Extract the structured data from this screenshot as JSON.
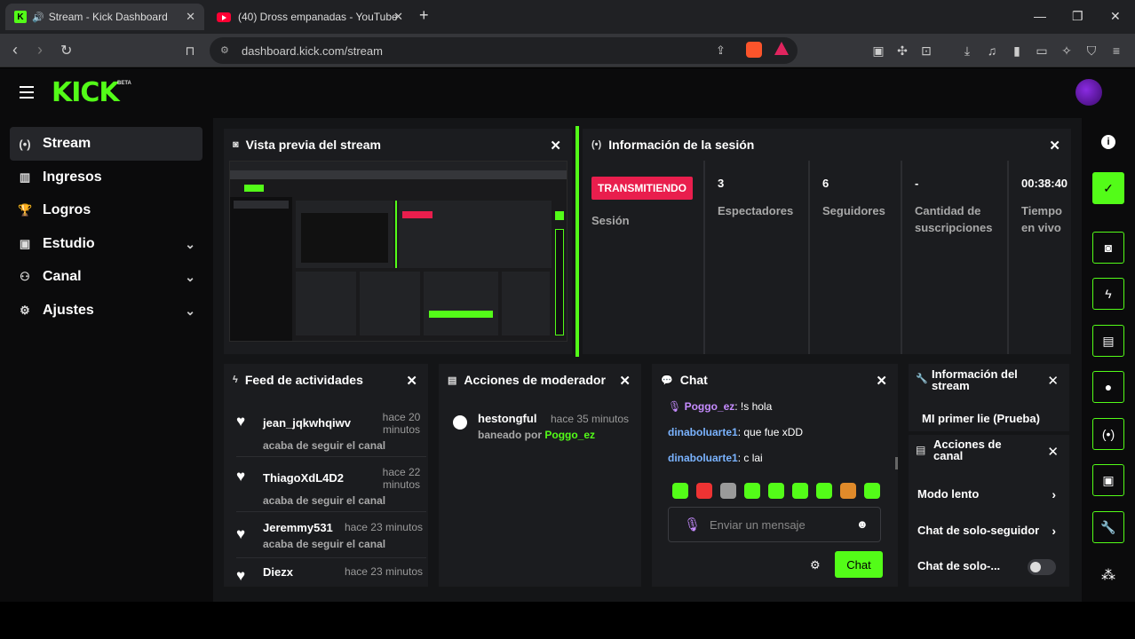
{
  "browser": {
    "tabs": [
      {
        "title": "Stream - Kick Dashboard"
      },
      {
        "title": "(40) Dross empanadas - YouTube"
      }
    ],
    "url": "dashboard.kick.com/stream"
  },
  "header": {
    "logo": "KICK",
    "beta": "BETA"
  },
  "sidebar": {
    "items": [
      {
        "label": "Stream",
        "icon": "broadcast-icon"
      },
      {
        "label": "Ingresos",
        "icon": "chart-icon"
      },
      {
        "label": "Logros",
        "icon": "trophy-icon"
      },
      {
        "label": "Estudio",
        "icon": "studio-icon"
      },
      {
        "label": "Canal",
        "icon": "users-icon"
      },
      {
        "label": "Ajustes",
        "icon": "gear-icon"
      }
    ]
  },
  "preview": {
    "title": "Vista previa del stream"
  },
  "session": {
    "title": "Información de la sesión",
    "badge": "TRANSMITIENDO",
    "session_label": "Sesión",
    "stats": [
      {
        "value": "3",
        "label": "Espectadores"
      },
      {
        "value": "6",
        "label": "Seguidores"
      },
      {
        "value": "-",
        "label": "Cantidad de suscripciones"
      },
      {
        "value": "00:38:40",
        "label": "Tiempo en vivo"
      }
    ]
  },
  "feed": {
    "title": "Feed de actividades",
    "items": [
      {
        "name": "jean_jqkwhqiwv",
        "when": "hace 20 minutos",
        "action": "acaba de seguir el canal"
      },
      {
        "name": "ThiagoXdL4D2",
        "when": "hace 22 minutos",
        "action": "acaba de seguir el canal"
      },
      {
        "name": "Jeremmy531",
        "when": "hace 23 minutos",
        "action": "acaba de seguir el canal"
      },
      {
        "name": "Diezx",
        "when": "hace 23 minutos",
        "action": ""
      }
    ]
  },
  "moderator": {
    "title": "Acciones de moderador",
    "item": {
      "name": "hestongful",
      "when": "hace 35 minutos",
      "action": "baneado por",
      "by": "Poggo_ez"
    }
  },
  "chat": {
    "title": "Chat",
    "messages": [
      {
        "user": "Poggo_ez",
        "text": ": !s hola"
      },
      {
        "user": "dinaboluarte1",
        "text": ": que fue xDD"
      },
      {
        "user": "dinaboluarte1",
        "text": ": c lai"
      }
    ],
    "placeholder": "Enviar un mensaje",
    "send": "Chat"
  },
  "stream_info": {
    "title": "Información del stream",
    "stream_title": "MI primer lie (Prueba)"
  },
  "channel_actions": {
    "title": "Acciones de canal",
    "rows": [
      "Modo lento",
      "Chat de solo-seguidor",
      "Chat de solo-..."
    ]
  },
  "colors": {
    "accent": "#53fc18",
    "live": "#e91e4d"
  }
}
